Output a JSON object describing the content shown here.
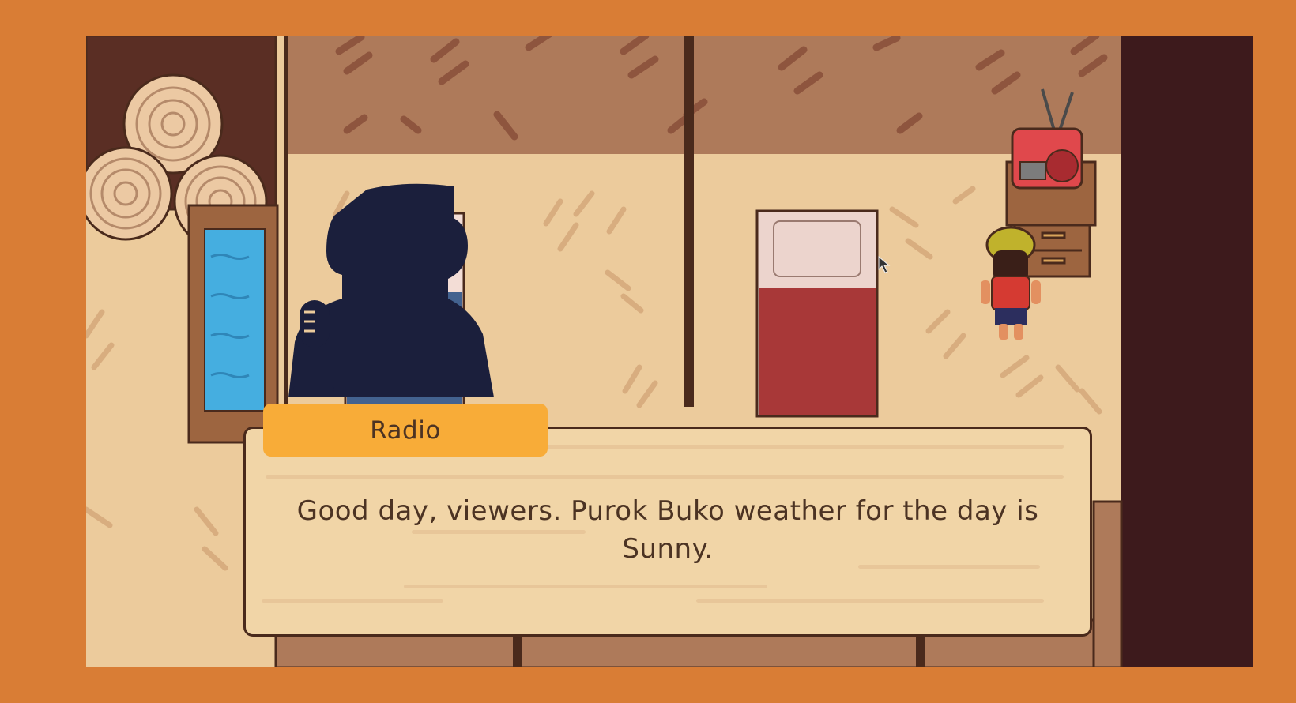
{
  "game": {
    "dialog": {
      "speaker": "Radio",
      "text": "Good day, viewers. Purok Buko weather for the day is Sunny."
    },
    "icons": {
      "cursor": "mouse-pointer-icon"
    },
    "colors": {
      "frame": "#d97d35",
      "speaker_tab": "#f8ac38",
      "dialog_box": "#f1d5a7",
      "dialog_text": "#4c3323",
      "floor": "#eccb9c",
      "wall": "#ae7a5a",
      "dark_wall": "#3d1a1c"
    }
  }
}
